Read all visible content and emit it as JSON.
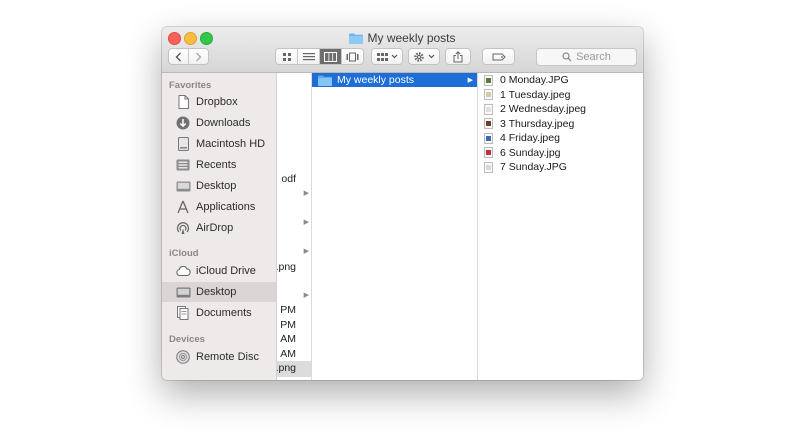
{
  "window": {
    "title": "My weekly posts"
  },
  "toolbar": {
    "search_placeholder": "Search"
  },
  "sidebar": {
    "sections": {
      "favorites": "Favorites",
      "icloud": "iCloud",
      "devices": "Devices"
    },
    "favorites": [
      {
        "label": "Dropbox",
        "icon": "dropbox-icon"
      },
      {
        "label": "Downloads",
        "icon": "downloads-icon"
      },
      {
        "label": "Macintosh HD",
        "icon": "hard-drive-icon"
      },
      {
        "label": "Recents",
        "icon": "recents-icon"
      },
      {
        "label": "Desktop",
        "icon": "desktop-icon"
      },
      {
        "label": "Applications",
        "icon": "applications-icon"
      },
      {
        "label": "AirDrop",
        "icon": "airdrop-icon"
      }
    ],
    "icloud": [
      {
        "label": "iCloud Drive",
        "icon": "cloud-icon"
      },
      {
        "label": "Desktop",
        "icon": "desktop-icon"
      },
      {
        "label": "Documents",
        "icon": "documents-icon"
      }
    ],
    "devices": [
      {
        "label": "Remote Disc",
        "icon": "disc-icon"
      }
    ]
  },
  "column1": {
    "fragments": [
      "odf",
      ".png",
      "PM",
      "PM",
      "AM",
      "AM",
      ".png"
    ]
  },
  "column2": {
    "selected_folder": "My weekly posts"
  },
  "column3": {
    "files": [
      {
        "name": "0 Monday.JPG",
        "color": "#5a7a3a"
      },
      {
        "name": "1 Tuesday.jpeg",
        "color": "#d8c8a8"
      },
      {
        "name": "2 Wednesday.jpeg",
        "color": "#e0e0e0"
      },
      {
        "name": "3 Thursday.jpeg",
        "color": "#6b4226"
      },
      {
        "name": "4 Friday.jpeg",
        "color": "#3b6ea8"
      },
      {
        "name": "6 Sunday.jpg",
        "color": "#c0303a"
      },
      {
        "name": "7 Sunday.JPG",
        "color": "#d8d8d8"
      }
    ]
  }
}
